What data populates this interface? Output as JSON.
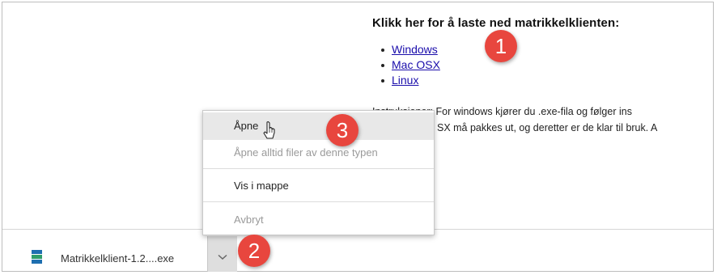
{
  "page": {
    "heading": "Klikk her for å laste ned matrikkelklienten:",
    "links": [
      "Windows",
      "Mac OSX",
      "Linux"
    ],
    "instructions": {
      "line1": "Instruksjoner: For windows kjører du .exe-fila og følger ins",
      "line2": "SX må pakkes ut, og deretter er de klar til bruk. A"
    }
  },
  "context_menu": {
    "items": [
      "Åpne",
      "Åpne alltid filer av denne typen",
      "Vis i mappe",
      "Avbryt"
    ],
    "hovered": "Åpne",
    "disabled": [
      "Åpne alltid filer av denne typen",
      "Avbryt"
    ]
  },
  "download_bar": {
    "file_name": "Matrikkelklient-1.2....exe",
    "file_icon": "installer-file-icon",
    "dropdown_icon": "chevron-down-icon"
  },
  "annotations": {
    "markers": [
      "1",
      "2",
      "3"
    ],
    "color": "#e8463e"
  },
  "colors": {
    "link": "#1a0dab",
    "menu_hover": "#e8e8e8",
    "dropdown_bg": "#dedede"
  }
}
